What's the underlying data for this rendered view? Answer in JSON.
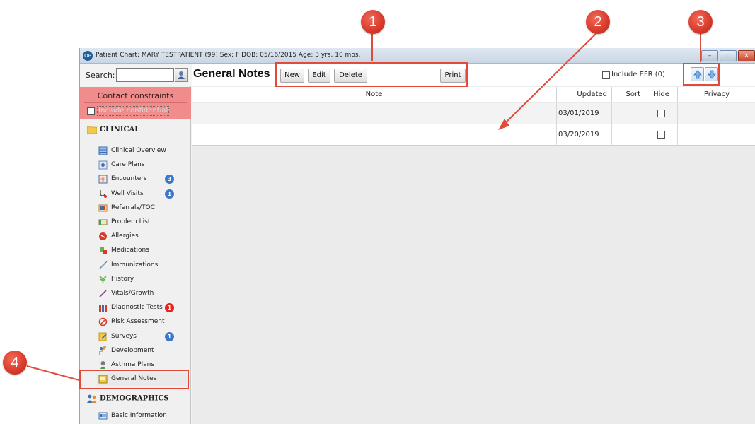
{
  "window": {
    "title": "Patient Chart: MARY TESTPATIENT (99)  Sex: F  DOB: 05/16/2015  Age: 3 yrs. 10 mos.",
    "minimize_glyph": "–",
    "maximize_glyph": "▫",
    "close_glyph": "×"
  },
  "sidebar": {
    "search_label": "Search:",
    "search_value": "",
    "constraints_header": "Contact constraints",
    "include_confidential": "Include confidential",
    "clinical_header": "CLINICAL",
    "demographics_header": "DEMOGRAPHICS",
    "clinical_items": [
      {
        "label": "Clinical Overview",
        "icon": "overview-icon"
      },
      {
        "label": "Care Plans",
        "icon": "care-plans-icon"
      },
      {
        "label": "Encounters",
        "icon": "encounters-icon",
        "badge": "3",
        "badge_color": "#3b78c8"
      },
      {
        "label": "Well Visits",
        "icon": "stethoscope-icon",
        "badge": "1",
        "badge_color": "#3b78c8"
      },
      {
        "label": "Referrals/TOC",
        "icon": "referrals-icon"
      },
      {
        "label": "Problem List",
        "icon": "problem-list-icon"
      },
      {
        "label": "Allergies",
        "icon": "allergies-icon"
      },
      {
        "label": "Medications",
        "icon": "medications-icon"
      },
      {
        "label": "Immunizations",
        "icon": "syringe-icon"
      },
      {
        "label": "History",
        "icon": "history-icon"
      },
      {
        "label": "Vitals/Growth",
        "icon": "vitals-icon"
      },
      {
        "label": "Diagnostic Tests",
        "icon": "test-tubes-icon",
        "badge": "1",
        "badge_color": "#e8231a"
      },
      {
        "label": "Risk Assessment",
        "icon": "risk-icon"
      },
      {
        "label": "Surveys",
        "icon": "surveys-icon",
        "badge": "1",
        "badge_color": "#3b78c8"
      },
      {
        "label": "Development",
        "icon": "development-icon"
      },
      {
        "label": "Asthma Plans",
        "icon": "asthma-icon"
      },
      {
        "label": "General Notes",
        "icon": "general-notes-icon"
      }
    ],
    "demographics_items": [
      {
        "label": "Basic Information",
        "icon": "basic-info-icon"
      }
    ]
  },
  "toolbar": {
    "title": "General Notes",
    "new_label": "New",
    "edit_label": "Edit",
    "delete_label": "Delete",
    "print_label": "Print",
    "include_efr": "Include EFR (0)"
  },
  "grid": {
    "columns": [
      "Note",
      "Updated",
      "Sort",
      "Hide",
      "Privacy"
    ],
    "rows": [
      {
        "note": "",
        "updated": "03/01/2019",
        "sort": "",
        "hide": false,
        "privacy": ""
      },
      {
        "note": "",
        "updated": "03/20/2019",
        "sort": "",
        "hide": false,
        "privacy": ""
      }
    ]
  },
  "callouts": [
    "1",
    "2",
    "3",
    "4"
  ],
  "colors": {
    "callout": "#d7392a",
    "constraints_bg": "#f08c8c",
    "badge_blue": "#3b78c8",
    "badge_red": "#e8231a"
  }
}
